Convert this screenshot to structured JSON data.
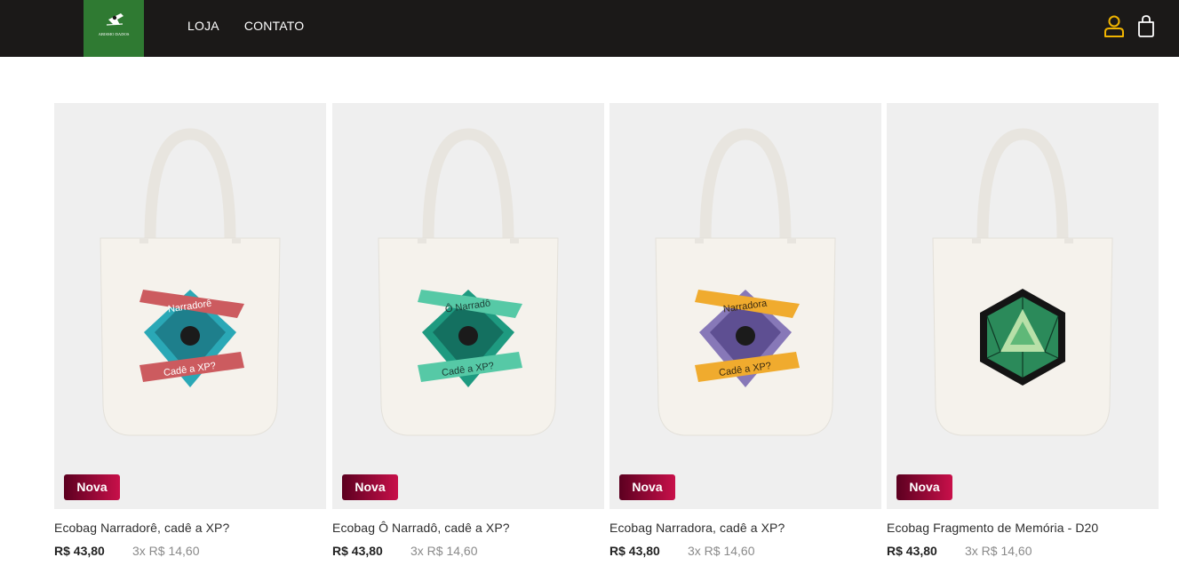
{
  "header": {
    "logo": {
      "text": "ABISMO DADOS",
      "background": "#2f7a32"
    },
    "nav": [
      {
        "label": "LOJA"
      },
      {
        "label": "CONTATO"
      }
    ],
    "icons": {
      "account": "user-icon",
      "cart": "shopping-bag-icon",
      "account_color": "#f0b400"
    }
  },
  "colors": {
    "badge_from": "#5c0020",
    "badge_to": "#c8104a",
    "header_bg": "#1b1918"
  },
  "products": [
    {
      "title": "Ecobag Narradorê, cadê a XP?",
      "price": "R$ 43,80",
      "installments": "3x R$ 14,60",
      "badge": "Nova",
      "artwork": {
        "type": "banner-dice",
        "banner_top": "Narradorê",
        "banner_bottom": "Cadê a XP?",
        "ribbon_color": "#cc5b5f",
        "gem_color": "#2aa8b6"
      }
    },
    {
      "title": "Ecobag Ô Narradô, cadê a XP?",
      "price": "R$ 43,80",
      "installments": "3x R$ 14,60",
      "badge": "Nova",
      "artwork": {
        "type": "banner-dice",
        "banner_top": "Ô Narradô",
        "banner_bottom": "Cadê a XP?",
        "ribbon_color": "#56c9a6",
        "gem_color": "#1e9a80"
      }
    },
    {
      "title": "Ecobag Narradora, cadê a XP?",
      "price": "R$ 43,80",
      "installments": "3x R$ 14,60",
      "badge": "Nova",
      "artwork": {
        "type": "banner-dice",
        "banner_top": "Narradora",
        "banner_bottom": "Cadê a XP?",
        "ribbon_color": "#f0ab2e",
        "gem_color": "#8778b8"
      }
    },
    {
      "title": "Ecobag Fragmento de Memória - D20",
      "price": "R$ 43,80",
      "installments": "3x R$ 14,60",
      "badge": "Nova",
      "artwork": {
        "type": "d20",
        "gem_color": "#2b8a5a"
      }
    }
  ]
}
